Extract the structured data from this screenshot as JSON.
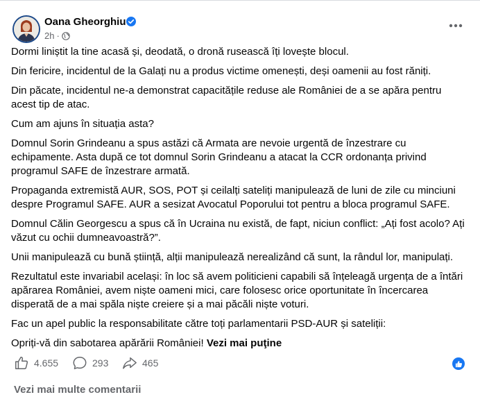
{
  "post": {
    "author": "Oana Gheorghiu",
    "time": "2h",
    "dot": "·",
    "paragraphs": [
      "Dormi liniștit la tine acasă și, deodată, o dronă rusească îți lovește blocul.",
      "Din fericire, incidentul de la Galați nu a produs victime omenești, deși oamenii au fost răniți.",
      "Din păcate, incidentul ne-a demonstrat capacitățile reduse ale României de a se apăra pentru acest tip de atac.",
      "Cum am ajuns în situația asta?",
      "Domnul Sorin Grindeanu a spus astăzi că Armata are nevoie urgentă de înzestrare cu echipamente. Asta după ce tot domnul Sorin Grindeanu a atacat la CCR ordonanța privind programul SAFE de înzestrare armată.",
      "Propaganda extremistă AUR, SOS, POT și ceilalți sateliți manipulează de luni de zile cu minciuni despre Programul SAFE. AUR a sesizat Avocatul Poporului tot pentru a bloca programul SAFE.",
      "Domnul Călin Georgescu a spus că în Ucraina nu există, de fapt, niciun conflict: „Ați fost acolo? Ați văzut cu ochii dumneavoastră?”.",
      "Unii manipulează cu bună știință, alții manipulează nerealizând că sunt, la rândul lor, manipulați.",
      "Rezultatul este invariabil același: în loc să avem politicieni capabili să înțeleagă urgența de a întări apărarea României, avem niște oameni mici, care folosesc orice oportunitate în încercarea disperată de a mai spăla niște creiere și a mai păcăli niște voturi.",
      "Fac un apel public la responsabilitate către toți parlamentarii PSD-AUR și sateliții:",
      "Opriți-vă din sabotarea apărării României!"
    ],
    "see_more": "Vezi mai puţine"
  },
  "actions": {
    "likes": "4.655",
    "comments": "293",
    "shares": "465"
  },
  "footer": {
    "view_more_comments": "Vezi mai multe comentarii"
  },
  "icons": {
    "verified": "verified-badge-icon",
    "privacy": "globe-icon",
    "more": "more-options-icon",
    "like": "thumbs-up-icon",
    "comment": "comment-bubble-icon",
    "share": "share-arrow-icon"
  },
  "colors": {
    "accent": "#1877f2",
    "secondary_text": "#65676b",
    "text": "#050505"
  }
}
